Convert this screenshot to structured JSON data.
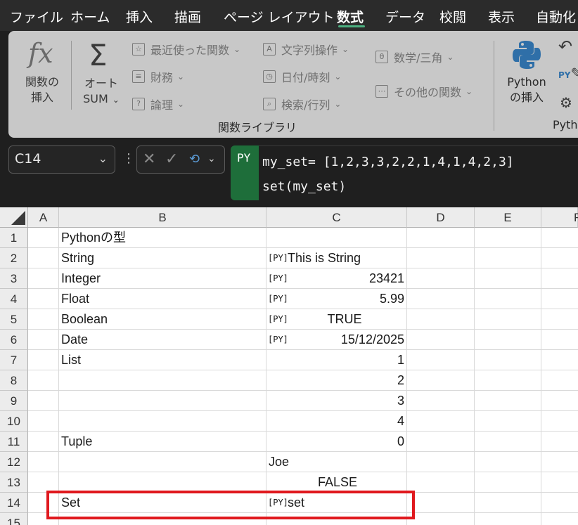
{
  "menu": {
    "tabs": [
      "ファイル",
      "ホーム",
      "挿入",
      "描画",
      "ページ レイアウト",
      "数式",
      "データ",
      "校閲",
      "表示",
      "自動化"
    ],
    "active_index": 5
  },
  "ribbon": {
    "insert_function_label": "関数の\n挿入",
    "insert_function_line1": "関数の",
    "insert_function_line2": "挿入",
    "autosum_line1": "オート",
    "autosum_line2": "SUM",
    "recent_label": "最近使った関数",
    "financial_label": "財務",
    "logical_label": "論理",
    "text_label": "文字列操作",
    "datetime_label": "日付/時刻",
    "lookup_label": "検索/行列",
    "math_label": "数学/三角",
    "more_label": "その他の関数",
    "group_label": "関数ライブラリ",
    "python_line1": "Python",
    "python_line2": "の挿入",
    "python_group_partial": "Pyth"
  },
  "namebox": {
    "value": "C14"
  },
  "formula": {
    "badge": "PY",
    "line1": "my_set= [1,2,3,3,2,2,1,4,1,4,2,3]",
    "line2": "set(my_set)"
  },
  "columns": [
    "A",
    "B",
    "C",
    "D",
    "E",
    "F"
  ],
  "rows": [
    "1",
    "2",
    "3",
    "4",
    "5",
    "6",
    "7",
    "8",
    "9",
    "10",
    "11",
    "12",
    "13",
    "14",
    "15"
  ],
  "cells": {
    "b1": "Pythonの型",
    "b2": "String",
    "b3": "Integer",
    "b4": "Float",
    "b5": "Boolean",
    "b6": "Date",
    "b7": "List",
    "b11": "Tuple",
    "b14": "Set",
    "c2": "This is String",
    "c3": "23421",
    "c4": "5.99",
    "c5": "TRUE",
    "c6": "15/12/2025",
    "c7": "1",
    "c8": "2",
    "c9": "3",
    "c10": "4",
    "c11": "0",
    "c12": "Joe",
    "c13": "FALSE",
    "c14": "set"
  },
  "py_cell_marker": "[PY]",
  "colors": {
    "accent_green": "#1e6e3a",
    "highlight_red": "#e0191e",
    "ribbon_bg": "#c8c8c8"
  }
}
